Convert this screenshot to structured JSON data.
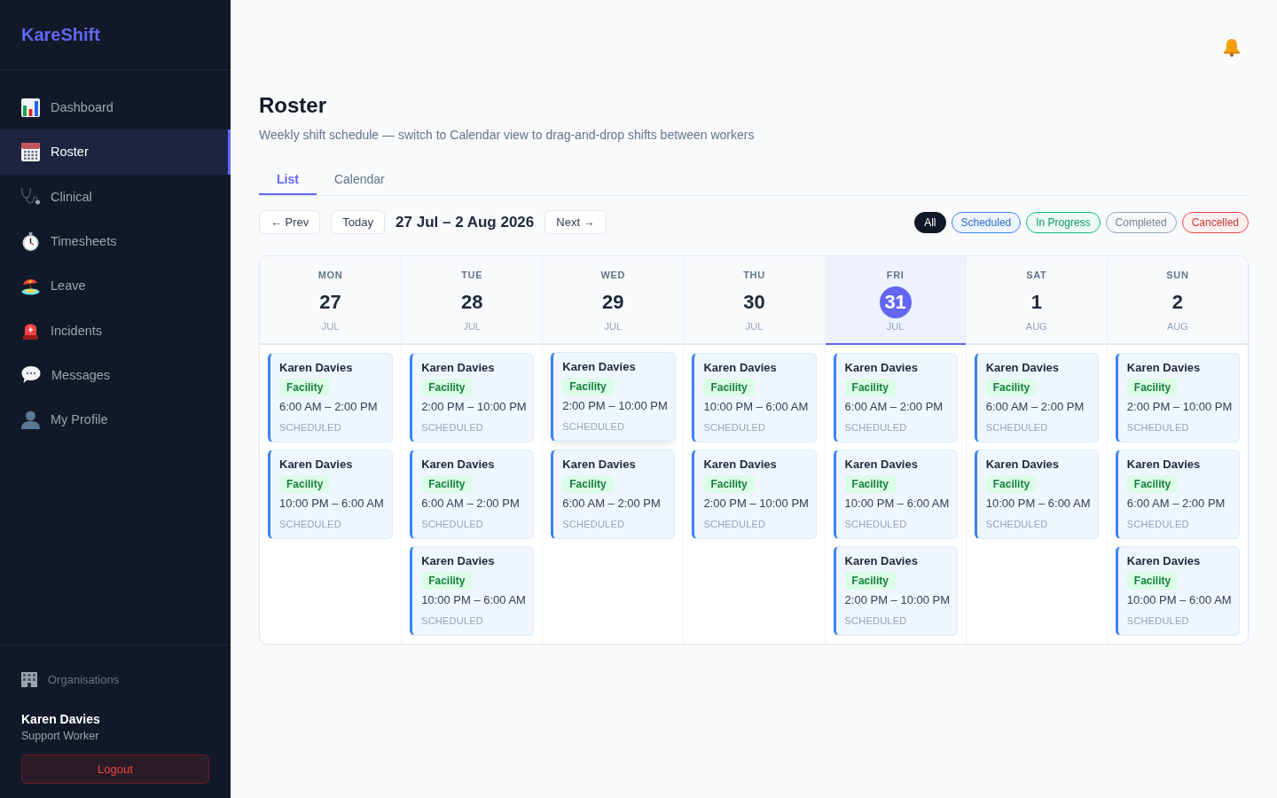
{
  "sidebar": {
    "brand": "KareShift",
    "nav": [
      {
        "label": "Dashboard",
        "selected": false
      },
      {
        "label": "Roster",
        "selected": true
      },
      {
        "label": "Clinical",
        "selected": false
      },
      {
        "label": "Timesheets",
        "selected": false
      },
      {
        "label": "Leave",
        "selected": false
      },
      {
        "label": "Incidents",
        "selected": false
      },
      {
        "label": "Messages",
        "selected": false
      },
      {
        "label": "My Profile",
        "selected": false
      }
    ],
    "organisations_link": "Organisations",
    "user": {
      "name": "Karen Davies",
      "role": "Support Worker"
    },
    "logout": "Logout"
  },
  "header": {
    "title": "Roster",
    "subtitle": "Weekly shift schedule — switch to Calendar view to drag-and-drop shifts between workers"
  },
  "tabs": [
    {
      "label": "List",
      "selected": true
    },
    {
      "label": "Calendar",
      "selected": false
    }
  ],
  "toolbar": {
    "prev": "← Prev",
    "today": "Today",
    "range": "27 Jul – 2 Aug 2026",
    "next": "Next →"
  },
  "filters": [
    {
      "label": "All",
      "selected": true,
      "color": "#111827"
    },
    {
      "label": "Scheduled",
      "selected": false,
      "color": "#3b82f6"
    },
    {
      "label": "In Progress",
      "selected": false,
      "color": "#10b981"
    },
    {
      "label": "Completed",
      "selected": false,
      "color": "#94a3b8"
    },
    {
      "label": "Cancelled",
      "selected": false,
      "color": "#ef4444"
    }
  ],
  "week": [
    {
      "weekday": "MON",
      "date": "27",
      "month": "JUL",
      "today": false,
      "shifts": [
        {
          "worker": "Karen Davies",
          "tag": "Facility",
          "time": "6:00 AM – 2:00 PM",
          "status": "SCHEDULED",
          "hovered": false
        },
        {
          "worker": "Karen Davies",
          "tag": "Facility",
          "time": "10:00 PM – 6:00 AM",
          "status": "SCHEDULED",
          "hovered": false
        }
      ]
    },
    {
      "weekday": "TUE",
      "date": "28",
      "month": "JUL",
      "today": false,
      "shifts": [
        {
          "worker": "Karen Davies",
          "tag": "Facility",
          "time": "2:00 PM – 10:00 PM",
          "status": "SCHEDULED",
          "hovered": false
        },
        {
          "worker": "Karen Davies",
          "tag": "Facility",
          "time": "6:00 AM – 2:00 PM",
          "status": "SCHEDULED",
          "hovered": false
        },
        {
          "worker": "Karen Davies",
          "tag": "Facility",
          "time": "10:00 PM – 6:00 AM",
          "status": "SCHEDULED",
          "hovered": false
        }
      ]
    },
    {
      "weekday": "WED",
      "date": "29",
      "month": "JUL",
      "today": false,
      "shifts": [
        {
          "worker": "Karen Davies",
          "tag": "Facility",
          "time": "2:00 PM – 10:00 PM",
          "status": "SCHEDULED",
          "hovered": true
        },
        {
          "worker": "Karen Davies",
          "tag": "Facility",
          "time": "6:00 AM – 2:00 PM",
          "status": "SCHEDULED",
          "hovered": false
        }
      ]
    },
    {
      "weekday": "THU",
      "date": "30",
      "month": "JUL",
      "today": false,
      "shifts": [
        {
          "worker": "Karen Davies",
          "tag": "Facility",
          "time": "10:00 PM – 6:00 AM",
          "status": "SCHEDULED",
          "hovered": false
        },
        {
          "worker": "Karen Davies",
          "tag": "Facility",
          "time": "2:00 PM – 10:00 PM",
          "status": "SCHEDULED",
          "hovered": false
        }
      ]
    },
    {
      "weekday": "FRI",
      "date": "31",
      "month": "JUL",
      "today": true,
      "shifts": [
        {
          "worker": "Karen Davies",
          "tag": "Facility",
          "time": "6:00 AM – 2:00 PM",
          "status": "SCHEDULED",
          "hovered": false
        },
        {
          "worker": "Karen Davies",
          "tag": "Facility",
          "time": "10:00 PM – 6:00 AM",
          "status": "SCHEDULED",
          "hovered": false
        },
        {
          "worker": "Karen Davies",
          "tag": "Facility",
          "time": "2:00 PM – 10:00 PM",
          "status": "SCHEDULED",
          "hovered": false
        }
      ]
    },
    {
      "weekday": "SAT",
      "date": "1",
      "month": "AUG",
      "today": false,
      "shifts": [
        {
          "worker": "Karen Davies",
          "tag": "Facility",
          "time": "6:00 AM – 2:00 PM",
          "status": "SCHEDULED",
          "hovered": false
        },
        {
          "worker": "Karen Davies",
          "tag": "Facility",
          "time": "10:00 PM – 6:00 AM",
          "status": "SCHEDULED",
          "hovered": false
        }
      ]
    },
    {
      "weekday": "SUN",
      "date": "2",
      "month": "AUG",
      "today": false,
      "shifts": [
        {
          "worker": "Karen Davies",
          "tag": "Facility",
          "time": "2:00 PM – 10:00 PM",
          "status": "SCHEDULED",
          "hovered": false
        },
        {
          "worker": "Karen Davies",
          "tag": "Facility",
          "time": "6:00 AM – 2:00 PM",
          "status": "SCHEDULED",
          "hovered": false
        },
        {
          "worker": "Karen Davies",
          "tag": "Facility",
          "time": "10:00 PM – 6:00 AM",
          "status": "SCHEDULED",
          "hovered": false
        }
      ]
    }
  ]
}
